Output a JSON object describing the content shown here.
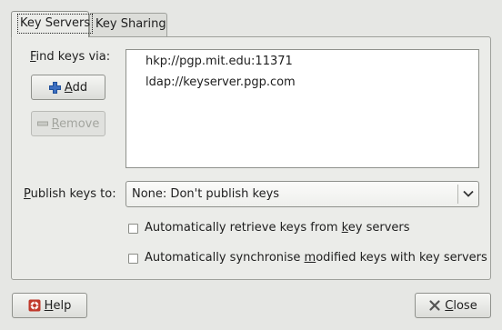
{
  "tabs": [
    {
      "label": "Key Servers",
      "active": true
    },
    {
      "label": "Key Sharing",
      "active": false
    }
  ],
  "servers": {
    "find_label_pre": "",
    "find_label_u": "F",
    "find_label_post": "ind keys via:",
    "add_button": {
      "pre": "",
      "u": "A",
      "post": "dd",
      "icon": "plus-icon"
    },
    "remove_button": {
      "pre": "",
      "u": "R",
      "post": "emove",
      "icon": "minus-icon",
      "enabled": false
    },
    "list": [
      "hkp://pgp.mit.edu:11371",
      "ldap://keyserver.pgp.com"
    ],
    "publish_label_pre": "",
    "publish_label_u": "P",
    "publish_label_post": "ublish keys to:",
    "publish_value": "None: Don't publish keys",
    "retrieve": {
      "pre": "Automatically retrieve keys from ",
      "u": "k",
      "post": "ey servers",
      "checked": false
    },
    "sync": {
      "pre": "Automatically synchronise ",
      "u": "m",
      "post": "odified keys with key servers",
      "checked": false
    }
  },
  "footer": {
    "help": {
      "pre": "",
      "u": "H",
      "post": "elp",
      "icon": "help-lifebuoy-icon"
    },
    "close": {
      "pre": "",
      "u": "C",
      "post": "lose",
      "icon": "close-x-icon"
    }
  },
  "colors": {
    "window_bg": "#e6e7e4",
    "panel_bg": "#ebece9",
    "border": "#9ea09b",
    "list_bg": "#ffffff"
  }
}
